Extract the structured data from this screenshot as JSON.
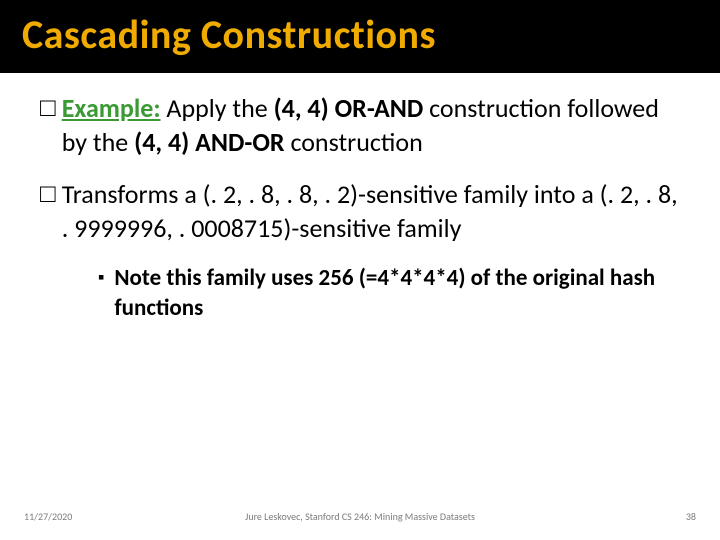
{
  "title": "Cascading Constructions",
  "bullets": {
    "b1": {
      "marker": "□",
      "example_label": "Example:",
      "t1": " Apply the ",
      "b1": "(4, 4) OR-AND",
      "t2": " construction followed by the ",
      "b2": "(4, 4) AND-OR",
      "t3": " construction"
    },
    "b2": {
      "marker": "□",
      "t1": "Transforms a ",
      "b1": "(. 2, . 8, . 8, . 2)-sensitive",
      "t2": " family into a ",
      "b2": "(. 2, . 8, . 9999996, . 0008715)-sensitive",
      "t3": " family"
    },
    "sub": {
      "marker": "▪",
      "text": "Note this family uses 256 (=4*4*4*4) of the original hash functions"
    }
  },
  "footer": {
    "date": "11/27/2020",
    "mid": "Jure Leskovec, Stanford CS 246: Mining Massive Datasets",
    "page": "38"
  }
}
